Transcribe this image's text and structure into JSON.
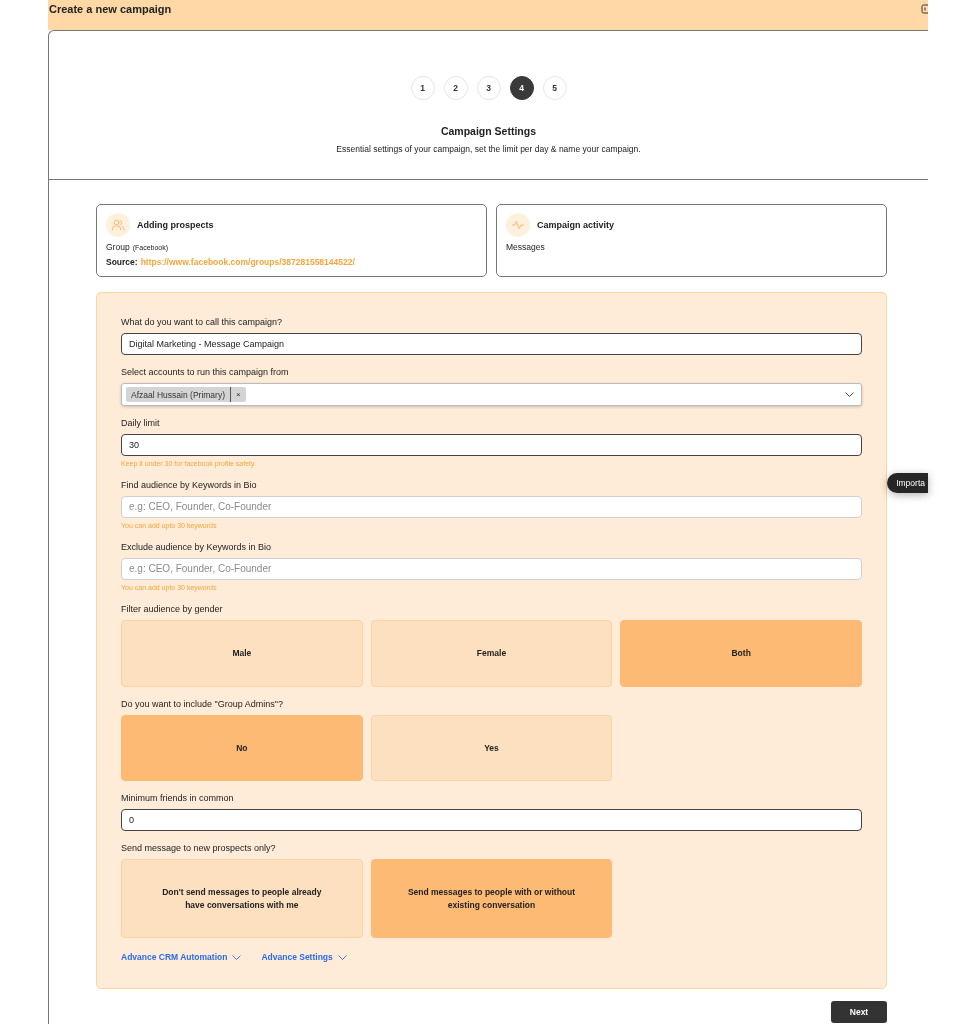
{
  "header": {
    "title": "Create a new campaign"
  },
  "stepper": {
    "steps": [
      {
        "label": "1",
        "selected": false
      },
      {
        "label": "2",
        "selected": false
      },
      {
        "label": "3",
        "selected": false
      },
      {
        "label": "4",
        "selected": true
      },
      {
        "label": "5",
        "selected": false
      }
    ],
    "title": "Campaign Settings",
    "subtitle": "Essential settings of your campaign, set the limit per day & name your campaign."
  },
  "prospects_card": {
    "title": "Adding prospects",
    "group_type": "Group",
    "group_platform": "(Facebook)",
    "source_label": "Source:",
    "source_url": "https://www.facebook.com/groups/387281558144522/"
  },
  "activity_card": {
    "title": "Campaign activity",
    "value": "Messages"
  },
  "form": {
    "fields": [
      {
        "kind": "text",
        "label": "What do you want to call this campaign?",
        "value": "Digital Marketing - Message Campaign"
      },
      {
        "kind": "select",
        "label": "Select accounts to run this campaign from",
        "tags": [
          {
            "label": "Afzaal Hussain (Primary)",
            "remove": "×"
          }
        ]
      },
      {
        "kind": "text",
        "label": "Daily limit",
        "value": "30",
        "hint": "Keep it under 30 for facebook profile safety"
      },
      {
        "kind": "text",
        "label": "Find audience by Keywords in Bio",
        "placeholder": "e.g: CEO, Founder, Co-Founder",
        "hint": "You can add upto 30 keywords"
      },
      {
        "kind": "text",
        "label": "Exclude audience by Keywords in Bio",
        "placeholder": "e.g: CEO, Founder, Co-Founder",
        "hint": "You can add upto 30 keywords"
      },
      {
        "kind": "choice",
        "label": "Filter audience by gender",
        "options": [
          {
            "label": "Male",
            "selected": false
          },
          {
            "label": "Female",
            "selected": false
          },
          {
            "label": "Both",
            "selected": true
          }
        ]
      },
      {
        "kind": "choice",
        "label": "Do you want to include \"Group Admins\"?",
        "options": [
          {
            "label": "No",
            "selected": true
          },
          {
            "label": "Yes",
            "selected": false
          }
        ]
      },
      {
        "kind": "text",
        "label": "Minimum friends in common",
        "value": "0"
      },
      {
        "kind": "choice",
        "label": "Send message to new prospects only?",
        "options": [
          {
            "label": "Don't send messages to people already have conversations with me",
            "selected": false
          },
          {
            "label": "Send messages to people with or without existing conversation",
            "selected": true
          }
        ]
      }
    ],
    "links": [
      {
        "label": "Advance CRM Automation",
        "expanded": false
      },
      {
        "label": "Advance Settings",
        "expanded": false
      }
    ]
  },
  "next_button": {
    "label": "Next"
  },
  "tooltip": {
    "text": "Importa"
  }
}
